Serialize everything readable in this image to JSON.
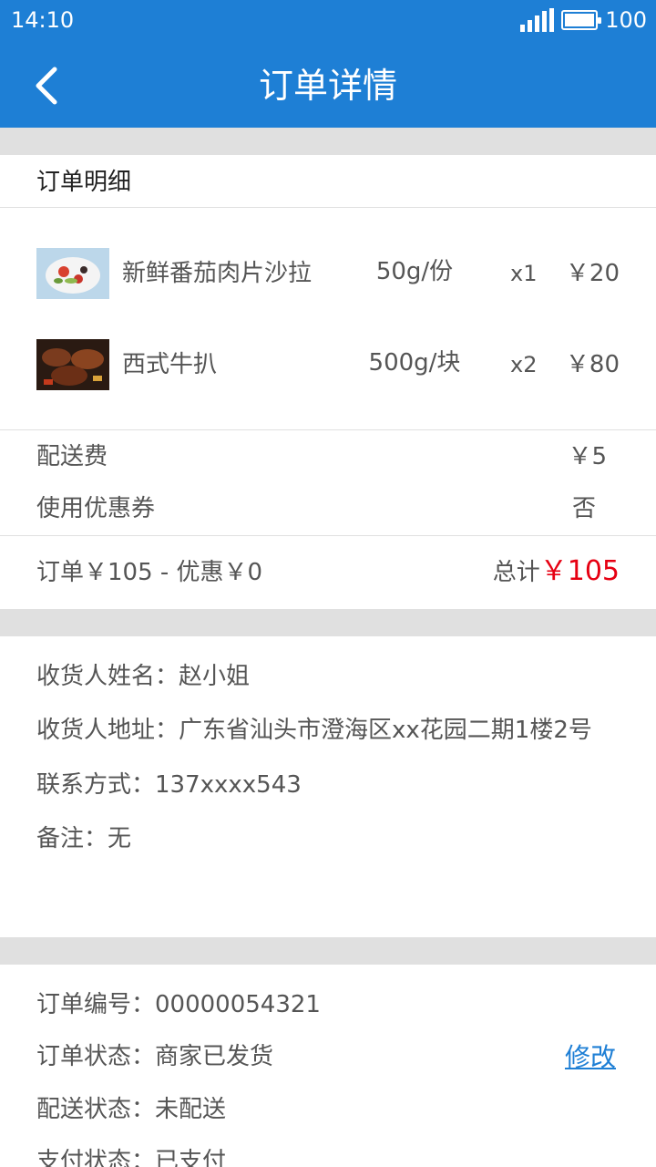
{
  "status_bar": {
    "time": "14:10",
    "battery": "100"
  },
  "header": {
    "title": "订单详情"
  },
  "order_detail": {
    "section_title": "订单明细",
    "items": [
      {
        "name": "新鲜番茄肉片沙拉",
        "spec": "50g/份",
        "qty": "x1",
        "price": "￥20"
      },
      {
        "name": "西式牛扒",
        "spec": "500g/块",
        "qty": "x2",
        "price": "￥80"
      }
    ],
    "delivery_fee_label": "配送费",
    "delivery_fee_value": "￥5",
    "coupon_label": "使用优惠券",
    "coupon_value": "否",
    "summary": "订单￥105 - 优惠￥0",
    "total_label": "总计",
    "total_amount": "￥105"
  },
  "receiver": {
    "name": "收货人姓名：赵小姐",
    "address": "收货人地址：广东省汕头市澄海区xx花园二期1楼2号",
    "contact": "联系方式：137xxxx543",
    "note": "备注：无"
  },
  "order_info": {
    "order_no": "订单编号：00000054321",
    "order_status": "订单状态：商家已发货",
    "edit_label": "修改",
    "delivery_status": "配送状态：未配送",
    "payment_status": "支付状态：已支付"
  },
  "colors": {
    "primary": "#1e7fd5",
    "price_red": "#e60012",
    "divider": "#e0e0e0"
  },
  "icons": {
    "back": "chevron-left-icon",
    "signal": "signal-icon",
    "battery": "battery-icon"
  }
}
